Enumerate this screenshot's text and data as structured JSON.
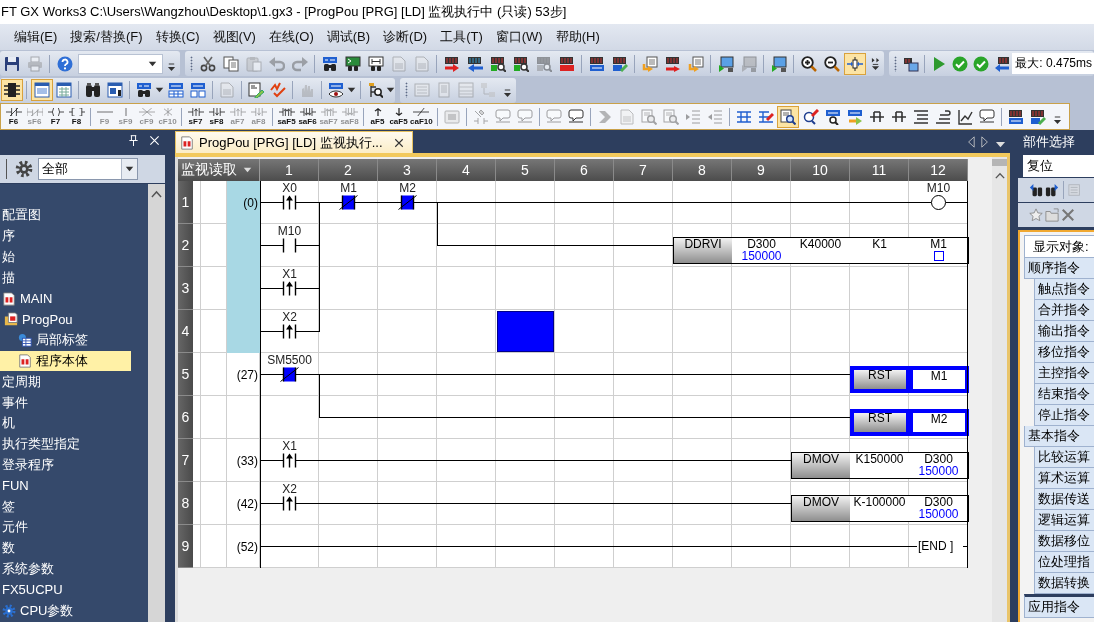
{
  "title_bar": {
    "title": "FT GX Works3 C:\\Users\\Wangzhou\\Desktop\\1.gx3 - [ProgPou [PRG] [LD] 监视执行中 (只读) 53步]"
  },
  "menu_bar": [
    "编辑(E)",
    "搜索/替换(F)",
    "转换(C)",
    "视图(V)",
    "在线(O)",
    "调试(B)",
    "诊断(D)",
    "工具(T)",
    "窗口(W)",
    "帮助(H)"
  ],
  "toolbars": [
    {
      "groups": [
        [
          {
            "disabled": false,
            "pressed": false
          },
          {
            "disabled": true,
            "pressed": false
          }
        ],
        [
          {
            "disabled": false,
            "pressed": false
          }
        ]
      ]
    },
    {
      "groups": [
        [
          {
            "disabled": false,
            "pressed": false
          },
          {
            "disabled": false,
            "pressed": false
          },
          {
            "disabled": true,
            "pressed": false
          },
          {
            "disabled": true,
            "pressed": false
          },
          {
            "disabled": true,
            "pressed": false
          }
        ],
        [
          {
            "disabled": false,
            "pressed": false
          },
          {
            "disabled": false,
            "pressed": false
          },
          {
            "disabled": false,
            "pressed": false
          },
          {
            "disabled": true,
            "pressed": false
          },
          {
            "disabled": true,
            "pressed": false
          }
        ],
        [
          {
            "disabled": false,
            "pressed": false
          },
          {
            "disabled": false,
            "pressed": false
          },
          {
            "disabled": false,
            "pressed": false
          },
          {
            "disabled": false,
            "pressed": false
          },
          {
            "disabled": true,
            "pressed": false
          },
          {
            "disabled": false,
            "pressed": false
          }
        ],
        [
          {
            "disabled": false,
            "pressed": false
          },
          {
            "disabled": false,
            "pressed": false
          }
        ],
        [
          {
            "disabled": false,
            "pressed": false
          },
          {
            "disabled": false,
            "pressed": false
          },
          {
            "disabled": false,
            "pressed": false
          }
        ],
        [
          {
            "disabled": false,
            "pressed": false
          },
          {
            "disabled": true,
            "pressed": false
          }
        ],
        [
          {
            "disabled": false,
            "pressed": false
          }
        ],
        [
          {
            "disabled": false,
            "pressed": false
          },
          {
            "disabled": false,
            "pressed": false
          },
          {
            "disabled": false,
            "pressed": true
          }
        ]
      ]
    },
    {
      "groups": [
        [
          {
            "disabled": false,
            "pressed": false
          }
        ],
        [
          {
            "disabled": false,
            "pressed": false
          },
          {
            "disabled": false,
            "pressed": false
          },
          {
            "disabled": false,
            "pressed": false
          },
          {
            "disabled": false,
            "pressed": false
          }
        ]
      ],
      "field_value": "最大: 0.475ms"
    },
    {
      "groups": [
        [
          {
            "disabled": false,
            "pressed": true
          }
        ],
        [
          {
            "disabled": false,
            "pressed": true
          },
          {
            "disabled": false,
            "pressed": false
          }
        ],
        [
          {
            "disabled": false,
            "pressed": false
          },
          {
            "disabled": false,
            "pressed": false
          }
        ],
        [
          {
            "disabled": false,
            "pressed": false
          },
          {
            "disabled": false,
            "pressed": false
          },
          {
            "disabled": false,
            "pressed": false
          }
        ],
        [
          {
            "disabled": true,
            "pressed": false
          }
        ],
        [
          {
            "disabled": false,
            "pressed": false
          },
          {
            "disabled": false,
            "pressed": false
          }
        ],
        [
          {
            "disabled": true,
            "pressed": false
          }
        ],
        [
          {
            "disabled": false,
            "pressed": false
          }
        ],
        [
          {
            "disabled": false,
            "pressed": false
          }
        ]
      ]
    },
    {
      "groups": [
        [
          {
            "disabled": true,
            "pressed": false
          },
          {
            "disabled": true,
            "pressed": false
          },
          {
            "disabled": true,
            "pressed": false
          },
          {
            "disabled": true,
            "pressed": false
          }
        ]
      ]
    },
    {
      "key_groups": [
        [
          {
            "label": "F6",
            "disabled": false
          },
          {
            "label": "sF6",
            "disabled": true
          },
          {
            "label": "F7",
            "disabled": false
          },
          {
            "label": "F8",
            "disabled": false
          }
        ],
        [
          {
            "label": "F9",
            "disabled": true
          },
          {
            "label": "sF9",
            "disabled": true
          },
          {
            "label": "cF9",
            "disabled": true
          },
          {
            "label": "cF10",
            "disabled": true
          }
        ],
        [
          {
            "label": "sF7",
            "disabled": false
          },
          {
            "label": "sF8",
            "disabled": false
          },
          {
            "label": "aF7",
            "disabled": true
          },
          {
            "label": "aF8",
            "disabled": true
          }
        ],
        [
          {
            "label": "saF5",
            "disabled": false
          },
          {
            "label": "saF6",
            "disabled": false
          },
          {
            "label": "saF7",
            "disabled": true
          },
          {
            "label": "saF8",
            "disabled": true
          }
        ],
        [
          {
            "label": "aF5",
            "disabled": false
          },
          {
            "label": "caF5",
            "disabled": false
          },
          {
            "label": "caF10",
            "disabled": false
          }
        ]
      ],
      "groups": [
        [
          {
            "disabled": true,
            "pressed": false
          }
        ],
        [
          {
            "disabled": true,
            "pressed": false
          },
          {
            "disabled": true,
            "pressed": false
          },
          {
            "disabled": true,
            "pressed": false
          }
        ],
        [
          {
            "disabled": true,
            "pressed": false
          },
          {
            "disabled": false,
            "pressed": false
          }
        ],
        [
          {
            "disabled": true,
            "pressed": false
          },
          {
            "disabled": true,
            "pressed": false
          },
          {
            "disabled": true,
            "pressed": false
          },
          {
            "disabled": true,
            "pressed": false
          },
          {
            "disabled": true,
            "pressed": false
          },
          {
            "disabled": true,
            "pressed": false
          }
        ],
        [
          {
            "disabled": false,
            "pressed": false
          },
          {
            "disabled": false,
            "pressed": false
          },
          {
            "disabled": false,
            "pressed": true
          },
          {
            "disabled": false,
            "pressed": false
          },
          {
            "disabled": false,
            "pressed": false
          },
          {
            "disabled": false,
            "pressed": false
          },
          {
            "disabled": false,
            "pressed": false
          },
          {
            "disabled": false,
            "pressed": false
          },
          {
            "disabled": false,
            "pressed": false
          },
          {
            "disabled": false,
            "pressed": false
          },
          {
            "disabled": false,
            "pressed": false
          },
          {
            "disabled": false,
            "pressed": false
          }
        ],
        [
          {
            "disabled": false,
            "pressed": false
          },
          {
            "disabled": false,
            "pressed": false
          }
        ]
      ]
    }
  ],
  "navigation": {
    "filter": "全部",
    "tree": [
      {
        "label": "配置图",
        "selected": false
      },
      {
        "label": "序",
        "selected": false,
        "children": [
          {
            "label": "始",
            "selected": false
          },
          {
            "label": "描",
            "selected": false,
            "children": [
              {
                "label": "MAIN",
                "kind": "program",
                "selected": false,
                "children": [
                  {
                    "label": "ProgPou",
                    "kind": "pou",
                    "selected": false,
                    "children": [
                      {
                        "label": "局部标签",
                        "kind": "labels",
                        "selected": false
                      },
                      {
                        "label": "程序本体",
                        "kind": "program",
                        "selected": true
                      }
                    ]
                  }
                ]
              }
            ]
          },
          {
            "label": "定周期",
            "selected": false
          },
          {
            "label": "事件",
            "selected": false
          },
          {
            "label": "机",
            "selected": false
          },
          {
            "label": "执行类型指定",
            "selected": false
          }
        ]
      },
      {
        "label": "登录程序",
        "selected": false
      },
      {
        "label": "FUN",
        "selected": false
      },
      {
        "label": "签",
        "selected": false
      },
      {
        "label": "元件",
        "selected": false
      },
      {
        "label": "数",
        "selected": false,
        "children": [
          {
            "label": "系统参数",
            "selected": false
          },
          {
            "label": "FX5UCPU",
            "selected": false,
            "children": [
              {
                "label": "CPU参数",
                "kind": "parameter",
                "selected": false
              }
            ]
          }
        ]
      }
    ]
  },
  "editor": {
    "tab": {
      "title": "ProgPou [PRG] [LD] 监视执行...",
      "selected": true
    },
    "ladder": {
      "mode": "监视读取",
      "columns": [
        "1",
        "2",
        "3",
        "4",
        "5",
        "6",
        "7",
        "8",
        "9",
        "10",
        "11",
        "12"
      ],
      "rows": [
        {
          "number": "1",
          "step": "(0)",
          "selected": true,
          "cells": [
            {
              "kind": "contact_pulse",
              "label": "X0",
              "on": false
            },
            {
              "kind": "contact_nc",
              "label": "M1",
              "on": true,
              "link_down": true
            },
            {
              "kind": "contact_nc",
              "label": "M2",
              "on": true
            },
            {
              "kind": "wire",
              "link_down": true
            },
            {
              "kind": "wire"
            },
            {
              "kind": "wire"
            },
            {
              "kind": "wire"
            },
            {
              "kind": "wire"
            },
            {
              "kind": "wire"
            },
            {
              "kind": "wire"
            },
            {
              "kind": "wire"
            },
            {
              "kind": "coil",
              "label": "M10",
              "on": false
            }
          ]
        },
        {
          "number": "2",
          "selected": true,
          "cells": [
            {
              "kind": "contact_no",
              "label": "M10",
              "on": false
            },
            {
              "kind": "empty",
              "link_down": true
            },
            {
              "kind": "empty"
            },
            {
              "kind": "wire"
            },
            {
              "kind": "wire"
            },
            {
              "kind": "wire"
            },
            {
              "kind": "wire"
            },
            {
              "kind": "op",
              "text": "DDRVI",
              "highlighted": false
            },
            {
              "kind": "operand",
              "text": "D300",
              "value": "150000",
              "highlighted": false
            },
            {
              "kind": "operand",
              "text": "K40000",
              "highlighted": false
            },
            {
              "kind": "operand",
              "text": "K1",
              "highlighted": false
            },
            {
              "kind": "operand",
              "text": "M1",
              "on": false,
              "highlighted": false
            }
          ]
        },
        {
          "number": "3",
          "selected": true,
          "cells": [
            {
              "kind": "contact_pulse",
              "label": "X1",
              "on": false
            },
            {
              "kind": "empty",
              "link_down": true
            },
            {
              "kind": "empty"
            },
            {
              "kind": "empty"
            },
            {
              "kind": "empty"
            },
            {
              "kind": "empty"
            },
            {
              "kind": "empty"
            },
            {
              "kind": "empty"
            },
            {
              "kind": "empty"
            },
            {
              "kind": "empty"
            },
            {
              "kind": "empty"
            },
            {
              "kind": "empty"
            }
          ]
        },
        {
          "number": "4",
          "selected": true,
          "cells": [
            {
              "kind": "contact_pulse",
              "label": "X2",
              "on": false
            },
            {
              "kind": "empty"
            },
            {
              "kind": "empty"
            },
            {
              "kind": "empty"
            },
            {
              "kind": "cursor"
            },
            {
              "kind": "empty"
            },
            {
              "kind": "empty"
            },
            {
              "kind": "empty"
            },
            {
              "kind": "empty"
            },
            {
              "kind": "empty"
            },
            {
              "kind": "empty"
            },
            {
              "kind": "empty"
            }
          ]
        },
        {
          "number": "5",
          "step": "(27)",
          "selected": false,
          "cells": [
            {
              "kind": "contact_nc",
              "label": "SM5500",
              "on": true
            },
            {
              "kind": "wire",
              "link_down": true
            },
            {
              "kind": "wire"
            },
            {
              "kind": "wire"
            },
            {
              "kind": "wire"
            },
            {
              "kind": "wire"
            },
            {
              "kind": "wire"
            },
            {
              "kind": "wire"
            },
            {
              "kind": "wire"
            },
            {
              "kind": "wire"
            },
            {
              "kind": "op",
              "text": "RST",
              "highlighted": true
            },
            {
              "kind": "operand",
              "text": "M1",
              "highlighted": true
            }
          ]
        },
        {
          "number": "6",
          "selected": false,
          "cells": [
            {
              "kind": "empty"
            },
            {
              "kind": "wire"
            },
            {
              "kind": "wire"
            },
            {
              "kind": "wire"
            },
            {
              "kind": "wire"
            },
            {
              "kind": "wire"
            },
            {
              "kind": "wire"
            },
            {
              "kind": "wire"
            },
            {
              "kind": "wire"
            },
            {
              "kind": "wire"
            },
            {
              "kind": "op",
              "text": "RST",
              "highlighted": true
            },
            {
              "kind": "operand",
              "text": "M2",
              "highlighted": true
            }
          ]
        },
        {
          "number": "7",
          "step": "(33)",
          "selected": false,
          "cells": [
            {
              "kind": "contact_pulse",
              "label": "X1",
              "on": false
            },
            {
              "kind": "wire"
            },
            {
              "kind": "wire"
            },
            {
              "kind": "wire"
            },
            {
              "kind": "wire"
            },
            {
              "kind": "wire"
            },
            {
              "kind": "wire"
            },
            {
              "kind": "wire"
            },
            {
              "kind": "wire"
            },
            {
              "kind": "op",
              "text": "DMOV",
              "highlighted": false
            },
            {
              "kind": "operand",
              "text": "K150000",
              "highlighted": false
            },
            {
              "kind": "operand",
              "text": "D300",
              "value": "150000",
              "highlighted": false
            }
          ]
        },
        {
          "number": "8",
          "step": "(42)",
          "selected": false,
          "cells": [
            {
              "kind": "contact_pulse",
              "label": "X2",
              "on": false
            },
            {
              "kind": "wire"
            },
            {
              "kind": "wire"
            },
            {
              "kind": "wire"
            },
            {
              "kind": "wire"
            },
            {
              "kind": "wire"
            },
            {
              "kind": "wire"
            },
            {
              "kind": "wire"
            },
            {
              "kind": "wire"
            },
            {
              "kind": "op",
              "text": "DMOV",
              "highlighted": false
            },
            {
              "kind": "operand",
              "text": "K-100000",
              "highlighted": false
            },
            {
              "kind": "operand",
              "text": "D300",
              "value": "150000",
              "highlighted": false
            }
          ]
        },
        {
          "number": "9",
          "step": "(52)",
          "selected": false,
          "cells": [
            {
              "kind": "wire"
            },
            {
              "kind": "wire"
            },
            {
              "kind": "wire"
            },
            {
              "kind": "wire"
            },
            {
              "kind": "wire"
            },
            {
              "kind": "wire"
            },
            {
              "kind": "wire"
            },
            {
              "kind": "wire"
            },
            {
              "kind": "wire"
            },
            {
              "kind": "wire"
            },
            {
              "kind": "wire"
            },
            {
              "kind": "end",
              "text": "[END ]"
            }
          ]
        }
      ]
    }
  },
  "parts_panel": {
    "title": "部件选择",
    "search": {
      "value": "复位"
    },
    "display_label": "显示对象:",
    "groups": [
      {
        "label": "顺序指令",
        "children": [
          "触点指令",
          "合并指令",
          "输出指令",
          "移位指令",
          "主控指令",
          "结束指令",
          "停止指令"
        ]
      },
      {
        "label": "基本指令",
        "children": [
          "比较运算",
          "算术运算",
          "数据传送",
          "逻辑运算",
          "数据移位",
          "位处理指",
          "数据转换"
        ]
      },
      {
        "label": "应用指令"
      }
    ]
  }
}
